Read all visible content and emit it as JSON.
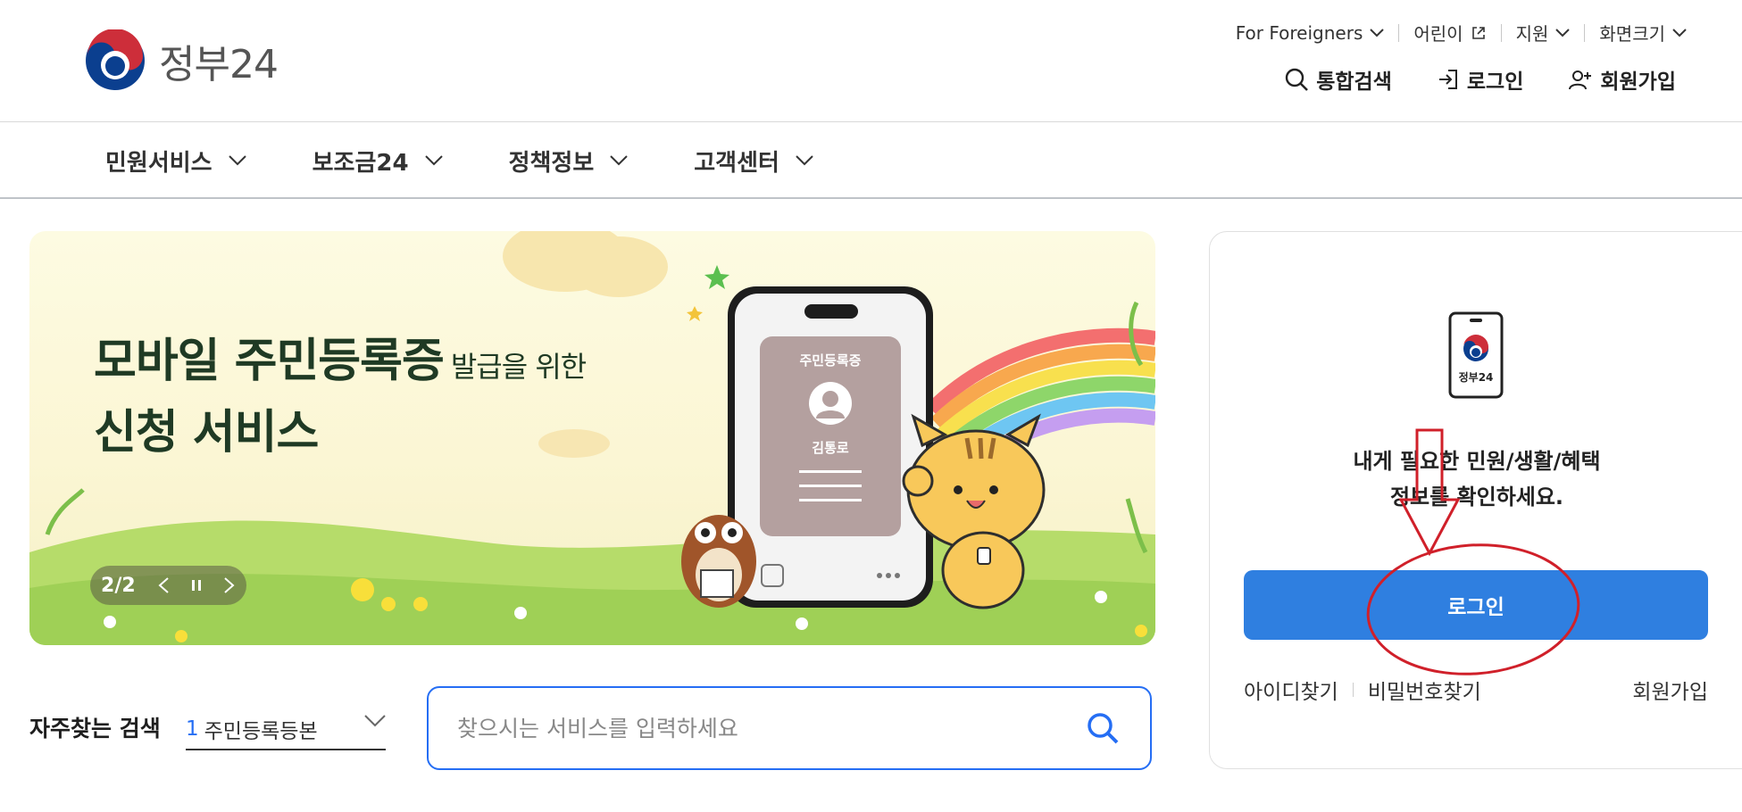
{
  "header": {
    "logo_text": "정부24",
    "util_links": [
      {
        "label": "For Foreigners"
      },
      {
        "label": "어린이"
      },
      {
        "label": "지원"
      },
      {
        "label": "화면크기"
      }
    ],
    "actions": {
      "search": "통합검색",
      "login": "로그인",
      "signup": "회원가입"
    }
  },
  "nav": {
    "items": [
      {
        "label": "민원서비스"
      },
      {
        "label": "보조금24"
      },
      {
        "label": "정책정보"
      },
      {
        "label": "고객센터"
      }
    ]
  },
  "banner": {
    "headline_main": "모바일 주민등록증",
    "headline_sub": "발급을 위한",
    "headline_line2": "신청 서비스",
    "slide_indicator": "2/2",
    "phone_card_title": "주민등록증",
    "phone_card_name": "김통로"
  },
  "frequent_search": {
    "label": "자주찾는 검색",
    "selected_num": "1",
    "selected_text": "주민등록등본"
  },
  "search": {
    "placeholder": "찾으시는 서비스를 입력하세요"
  },
  "login_panel": {
    "device_logo_text": "정부24",
    "message_line1": "내게 필요한 민원/생활/혜택",
    "message_line2": "정보를 확인하세요.",
    "login_button": "로그인",
    "find_id": "아이디찾기",
    "find_password": "비밀번호찾기",
    "signup": "회원가입"
  },
  "colors": {
    "accent": "#256ef4",
    "login_button": "#2f7fe0",
    "annotation": "#d0202a"
  }
}
